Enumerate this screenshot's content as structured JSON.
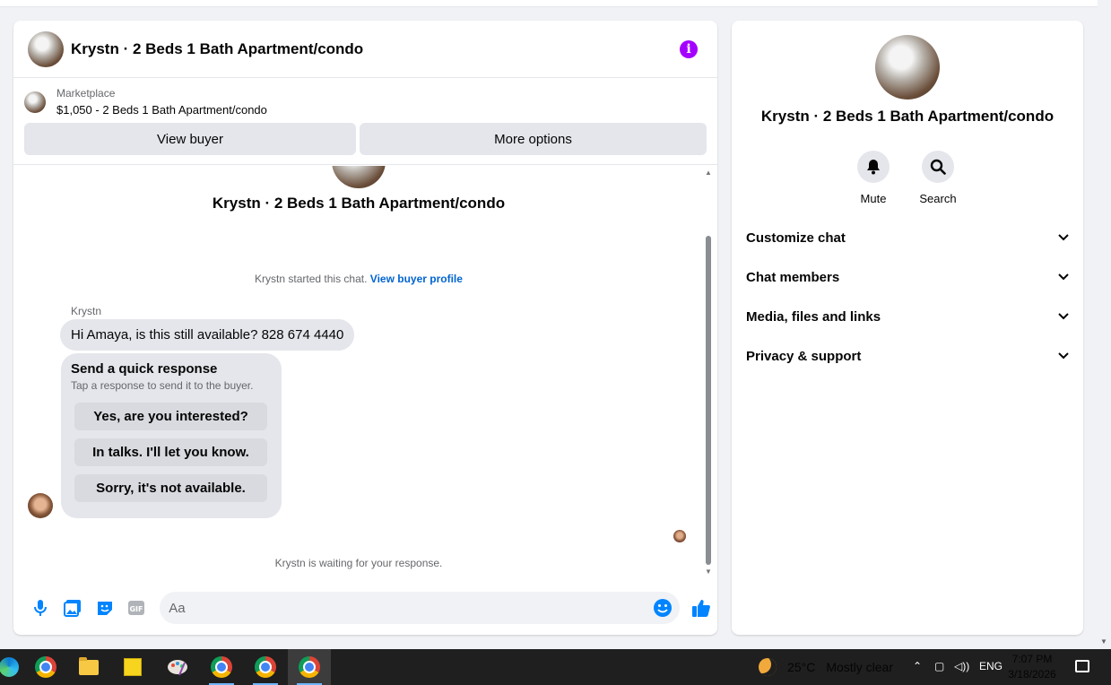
{
  "chat": {
    "title": "Krystn · 2 Beds 1 Bath Apartment/condo",
    "marketplace_label": "Marketplace",
    "listing": "$1,050 - 2 Beds 1 Bath Apartment/condo",
    "view_buyer": "View buyer",
    "more_options": "More options",
    "conversation_title": "Krystn · 2 Beds 1 Bath Apartment/condo",
    "started_text": "Krystn started this chat.",
    "view_buyer_profile": "View buyer profile",
    "sender_name": "Krystn",
    "message": "Hi Amaya, is this still available? 828 674 4440",
    "quick_title": "Send a quick response",
    "quick_subtitle": "Tap a response to send it to the buyer.",
    "quick_replies": [
      "Yes, are you interested?",
      "In talks. I'll let you know.",
      "Sorry, it's not available."
    ],
    "waiting_text": "Krystn is waiting for your response.",
    "input_placeholder": "Aa"
  },
  "info": {
    "title": "Krystn · 2 Beds 1 Bath Apartment/condo",
    "mute": "Mute",
    "search": "Search",
    "sections": [
      "Customize chat",
      "Chat members",
      "Media, files and links",
      "Privacy & support"
    ]
  },
  "taskbar": {
    "temperature": "25°C",
    "weather": "Mostly clear",
    "language": "ENG",
    "time": "7:07 PM",
    "date": "3/18/2026"
  },
  "colors": {
    "accent_purple": "#a400ff",
    "accent_blue": "#0084ff",
    "link_blue": "#0064d1"
  }
}
